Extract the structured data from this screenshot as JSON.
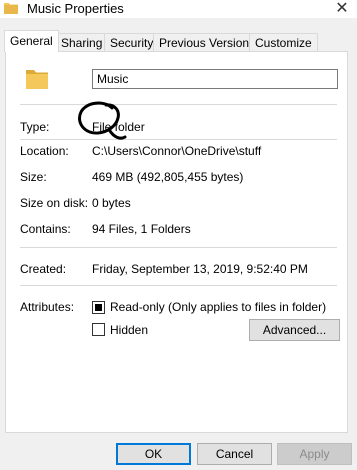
{
  "window": {
    "title": "Music Properties",
    "close_glyph": "✕"
  },
  "tabs": [
    "General",
    "Sharing",
    "Security",
    "Previous Versions",
    "Customize"
  ],
  "general": {
    "name_value": "Music",
    "type_label": "Type:",
    "type_value": "File folder",
    "location_label": "Location:",
    "location_value": "C:\\Users\\Connor\\OneDrive\\stuff",
    "size_label": "Size:",
    "size_value": "469 MB (492,805,455 bytes)",
    "size_on_disk_label": "Size on disk:",
    "size_on_disk_value": "0 bytes",
    "contains_label": "Contains:",
    "contains_value": "94 Files, 1 Folders",
    "created_label": "Created:",
    "created_value": "Friday, September 13, 2019, 9:52:40 PM",
    "attributes_label": "Attributes:",
    "readonly_label": "Read-only (Only applies to files in folder)",
    "readonly_checked": true,
    "hidden_label": "Hidden",
    "hidden_checked": false,
    "advanced_label": "Advanced..."
  },
  "buttons": {
    "ok": "OK",
    "cancel": "Cancel",
    "apply": "Apply"
  },
  "colors": {
    "folder": "#f4c85a",
    "folder_dark": "#dcaa36",
    "accent": "#0078d7"
  },
  "icons": {
    "title": "folder-icon",
    "big": "folder-icon",
    "close": "close-icon"
  }
}
